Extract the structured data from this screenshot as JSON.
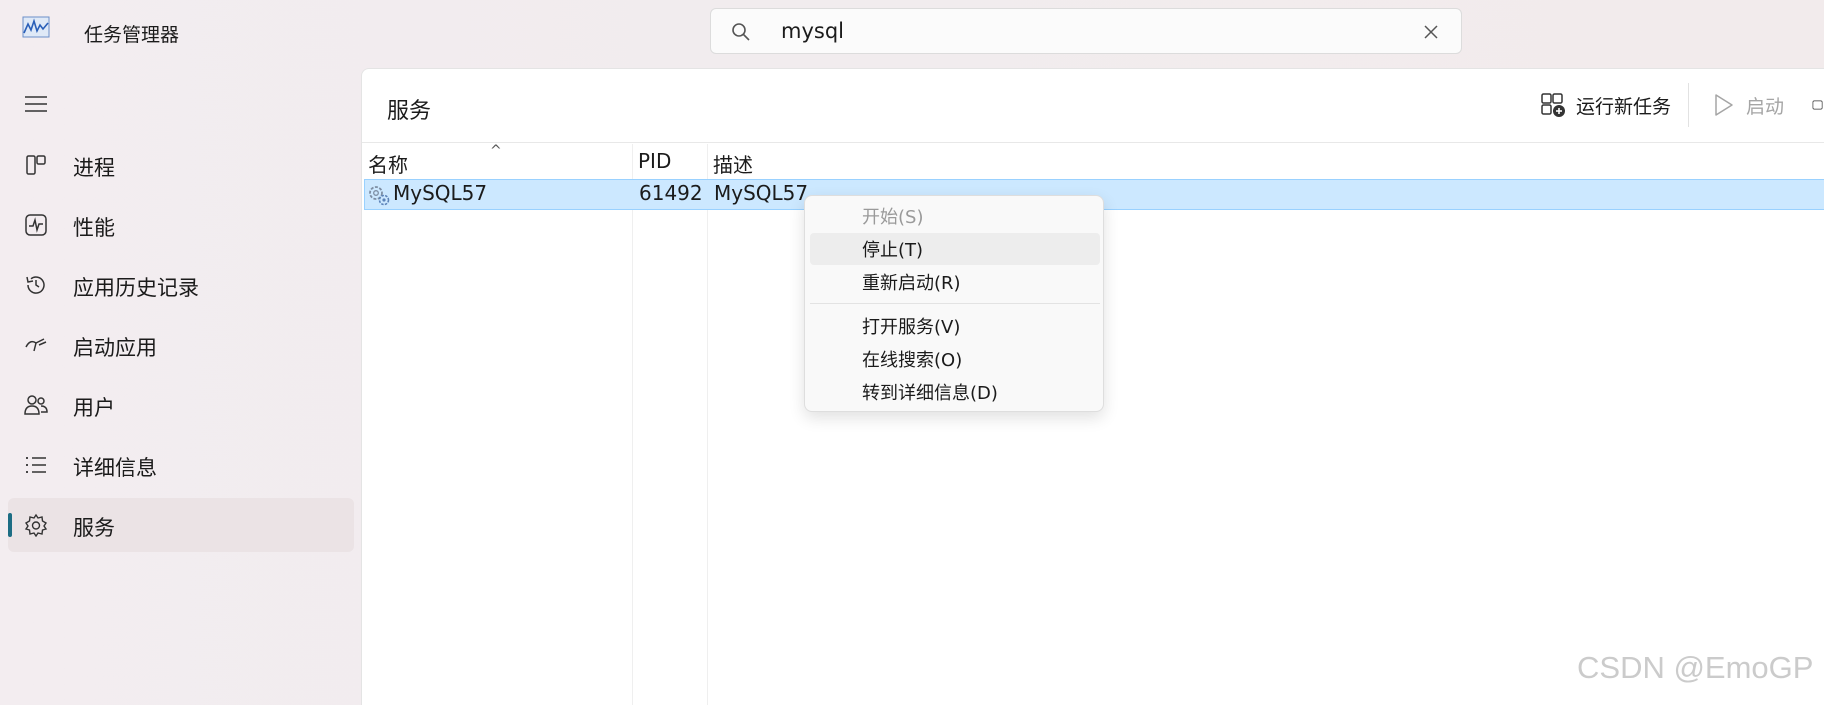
{
  "app": {
    "title": "任务管理器",
    "icon": "task-manager-chart-icon"
  },
  "search": {
    "value": "mysql",
    "icon": "search-icon",
    "clear_icon": "close-icon"
  },
  "sidebar": {
    "menu_icon": "hamburger-icon",
    "items": [
      {
        "label": "进程",
        "icon": "processes-icon"
      },
      {
        "label": "性能",
        "icon": "performance-icon"
      },
      {
        "label": "应用历史记录",
        "icon": "history-icon"
      },
      {
        "label": "启动应用",
        "icon": "startup-icon"
      },
      {
        "label": "用户",
        "icon": "users-icon"
      },
      {
        "label": "详细信息",
        "icon": "details-list-icon"
      },
      {
        "label": "服务",
        "icon": "services-gear-icon",
        "active": true
      }
    ],
    "accent": "#1d6d84"
  },
  "main": {
    "title": "服务",
    "toolbar": {
      "run_new_task": "运行新任务",
      "start": "启动"
    },
    "columns": {
      "name": "名称",
      "pid": "PID",
      "description": "描述"
    },
    "rows": [
      {
        "name": "MySQL57",
        "pid": "61492",
        "description": "MySQL57",
        "selected": true
      }
    ],
    "selection_color": "#cce8ff"
  },
  "context_menu": {
    "items": [
      {
        "label": "开始(S)",
        "disabled": true
      },
      {
        "label": "停止(T)",
        "hover": true
      },
      {
        "label": "重新启动(R)"
      },
      {
        "label": "打开服务(V)"
      },
      {
        "label": "在线搜索(O)"
      },
      {
        "label": "转到详细信息(D)"
      }
    ]
  },
  "watermark": "CSDN @EmoGP"
}
